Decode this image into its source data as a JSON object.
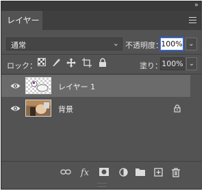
{
  "panel": {
    "collapse_icon": "double-chevron-right",
    "tab_label": "レイヤー",
    "menu_icon": "hamburger-menu"
  },
  "controls": {
    "blend_mode": "通常",
    "opacity_label": "不透明度：",
    "opacity_value": "100%",
    "lock_label": "ロック：",
    "fill_label": "塗り：",
    "fill_value": "100%"
  },
  "layers": [
    {
      "name": "レイヤー 1",
      "selected": true,
      "visible": true,
      "locked": false
    },
    {
      "name": "背景",
      "selected": false,
      "visible": true,
      "locked": true
    }
  ],
  "colors": {
    "panel_bg": "#535353",
    "selected_row": "#6b6b6b",
    "focus_border": "#3d6fd1"
  },
  "toolbar_icons": [
    "link-icon",
    "fx-icon",
    "mask-icon",
    "adjustment-icon",
    "folder-icon",
    "new-layer-icon",
    "trash-icon"
  ]
}
